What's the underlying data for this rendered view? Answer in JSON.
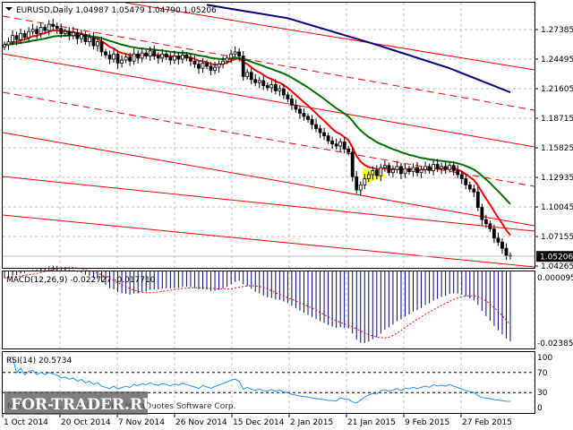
{
  "chart_data": {
    "type": "candlestick",
    "title": "EURUSD,Daily",
    "ohlc_readout": {
      "open": "1.04987",
      "high": "1.05479",
      "low": "1.04790",
      "close": "1.05206"
    },
    "price_ticks": [
      "1.27385",
      "1.24495",
      "1.21605",
      "1.18715",
      "1.15825",
      "1.12935",
      "1.10045",
      "1.07155",
      "1.04265"
    ],
    "bid_label": "1.05206",
    "ylim": [
      1.039,
      1.3
    ],
    "date_ticks": [
      "1 Oct 2014",
      "20 Oct 2014",
      "7 Nov 2014",
      "26 Nov 2014",
      "15 Dec 2014",
      "2 Jan 2015",
      "21 Jan 2015",
      "9 Feb 2015",
      "27 Feb 2015"
    ],
    "closes": [
      1.259,
      1.262,
      1.268,
      1.264,
      1.27,
      1.266,
      1.272,
      1.274,
      1.27,
      1.276,
      1.273,
      1.279,
      1.277,
      1.275,
      1.27,
      1.272,
      1.268,
      1.271,
      1.265,
      1.269,
      1.262,
      1.266,
      1.258,
      1.262,
      1.252,
      1.249,
      1.245,
      1.25,
      1.241,
      1.244,
      1.247,
      1.243,
      1.25,
      1.246,
      1.251,
      1.248,
      1.253,
      1.248,
      1.246,
      1.25,
      1.247,
      1.244,
      1.248,
      1.245,
      1.249,
      1.246,
      1.243,
      1.24,
      1.236,
      1.241,
      1.238,
      1.234,
      1.237,
      1.24,
      1.243,
      1.246,
      1.25,
      1.252,
      1.248,
      1.228,
      1.232,
      1.225,
      1.222,
      1.224,
      1.219,
      1.217,
      1.22,
      1.214,
      1.216,
      1.21,
      1.206,
      1.2,
      1.196,
      1.192,
      1.189,
      1.186,
      1.181,
      1.177,
      1.173,
      1.17,
      1.165,
      1.162,
      1.16,
      1.164,
      1.157,
      1.154,
      1.13,
      1.117,
      1.122,
      1.128,
      1.132,
      1.136,
      1.131,
      1.139,
      1.141,
      1.134,
      1.137,
      1.14,
      1.133,
      1.138,
      1.135,
      1.139,
      1.134,
      1.137,
      1.14,
      1.136,
      1.142,
      1.138,
      1.14,
      1.137,
      1.141,
      1.136,
      1.132,
      1.128,
      1.122,
      1.118,
      1.115,
      1.1,
      1.088,
      1.084,
      1.079,
      1.07,
      1.066,
      1.06,
      1.053,
      1.052
    ],
    "long_ma": [
      [
        50,
        1.298
      ],
      [
        70,
        1.285
      ],
      [
        92,
        1.259
      ],
      [
        110,
        1.236
      ],
      [
        125,
        1.2125
      ]
    ],
    "macd": {
      "label": "MACD(12,26,9) -0.022727 -0.017710",
      "ticks": [
        "0.000095",
        "-0.023859"
      ],
      "ylim": [
        -0.0255,
        9.5e-05
      ]
    },
    "rsi": {
      "label": "RSI(14) 20.5734",
      "ticks": [
        "100",
        "70",
        "30",
        "0"
      ],
      "levels": [
        70,
        30
      ]
    },
    "colors": {
      "bull": "#ffffff",
      "bear": "#000000",
      "fast_ma": "#ff0000",
      "mid_ma": "#007000",
      "long_ma": "#000080",
      "trend": "#ff0000",
      "macd_hist": "#000080",
      "macd_signal": "#ff0000",
      "rsi": "#1e90ff",
      "grid": "#c0c0c0"
    },
    "grid": true
  },
  "footer": {
    "copyright": "MetaTrader 4, © 2001-2014, MetaQuotes Software Corp.",
    "watermark": "FOR-TRADER.RU"
  }
}
